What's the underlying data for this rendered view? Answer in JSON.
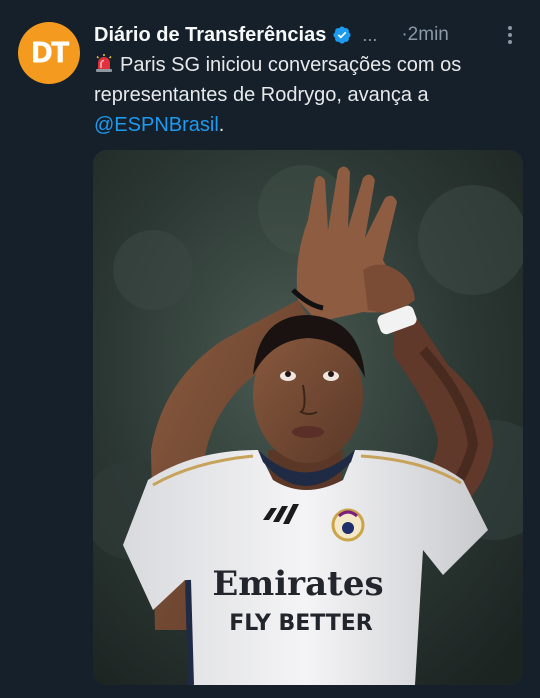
{
  "account": {
    "avatar_text": "DT",
    "display_name": "Diário de Transferências",
    "handle_truncated": "...",
    "time": "·2min"
  },
  "tweet": {
    "text_main": "Paris SG iniciou conversações com os representantes de Rodrygo, avança a ",
    "mention": "@ESPNBrasil",
    "text_end": "."
  },
  "media": {
    "shirt_sponsor_line1": "Emirates",
    "shirt_sponsor_line2": "FLY BETTER"
  },
  "colors": {
    "background": "#15202b",
    "accent": "#1d9bf0",
    "avatar": "#f39a1f",
    "secondary_text": "#8b98a5"
  },
  "icons": [
    "verified-badge-icon",
    "more-options-icon",
    "siren-emoji-icon"
  ]
}
